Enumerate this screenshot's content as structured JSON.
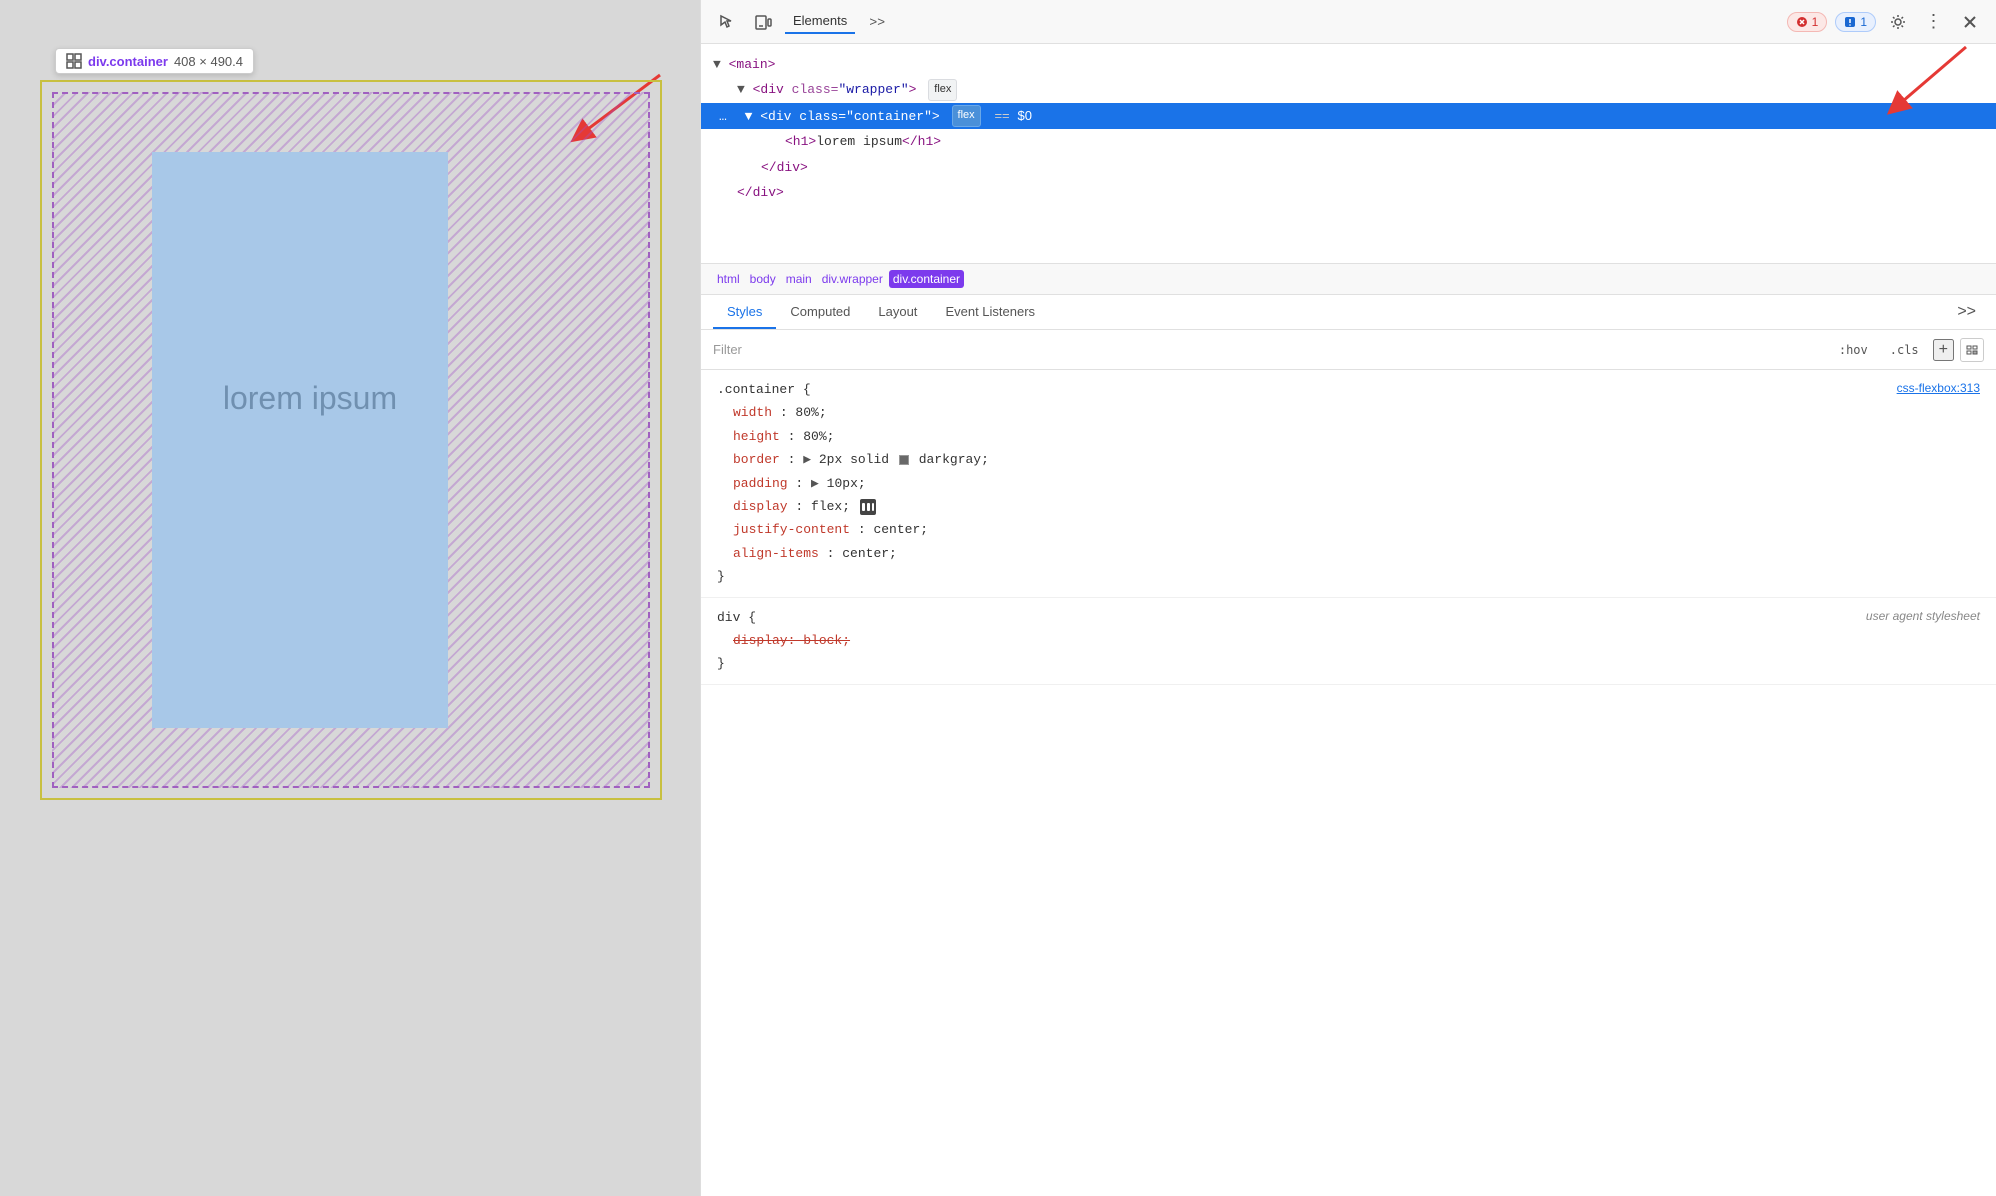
{
  "preview": {
    "tooltip": {
      "element": "div.container",
      "dimensions": "408 × 490.4"
    },
    "lorem_text": "lorem ipsum"
  },
  "devtools": {
    "toolbar": {
      "active_tab": "Elements",
      "errors_count": "1",
      "warnings_count": "1"
    },
    "dom": {
      "lines": [
        {
          "indent": 0,
          "content": "▼<main>",
          "selected": false
        },
        {
          "indent": 1,
          "content": "▼<div class=\"wrapper\">",
          "badge": "flex",
          "selected": false
        },
        {
          "indent": 2,
          "content": "▼<div class=\"container\">",
          "badge": "flex",
          "eq": "== $0",
          "selected": true
        },
        {
          "indent": 3,
          "content": "<h1>lorem ipsum</h1>",
          "selected": false
        },
        {
          "indent": 2,
          "content": "</div>",
          "selected": false
        },
        {
          "indent": 1,
          "content": "</div>",
          "selected": false
        }
      ]
    },
    "breadcrumb": {
      "items": [
        "html",
        "body",
        "main",
        "div.wrapper",
        "div.container"
      ]
    },
    "tabs": [
      "Styles",
      "Computed",
      "Layout",
      "Event Listeners",
      ">>"
    ],
    "active_tab": "Styles",
    "filter": {
      "placeholder": "Filter",
      "hov_btn": ":hov",
      "cls_btn": ".cls"
    },
    "rules": [
      {
        "selector": ".container {",
        "source": "css-flexbox:313",
        "properties": [
          {
            "name": "width",
            "value": "80%;"
          },
          {
            "name": "height",
            "value": "80%;"
          },
          {
            "name": "border",
            "value": "▶ 2px solid",
            "swatch": true,
            "swatch_color": "#696969",
            "value2": "darkgray;"
          },
          {
            "name": "padding",
            "value": "▶ 10px;"
          },
          {
            "name": "display",
            "value": "flex;",
            "flex_icon": true
          },
          {
            "name": "justify-content",
            "value": "center;"
          },
          {
            "name": "align-items",
            "value": "center;"
          }
        ]
      },
      {
        "selector": "div {",
        "source_ua": "user agent stylesheet",
        "properties": [
          {
            "name": "display",
            "value": "block;",
            "strikethrough": true
          }
        ]
      }
    ]
  }
}
